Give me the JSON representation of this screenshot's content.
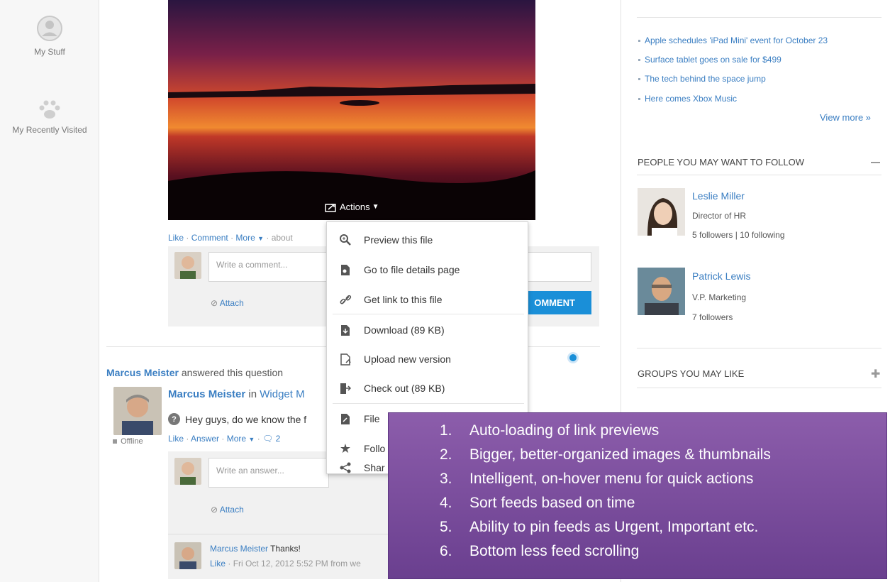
{
  "leftnav": {
    "my_stuff": "My Stuff",
    "recently_visited": "My Recently Visited"
  },
  "post1": {
    "actions_label": "Actions",
    "like": "Like",
    "comment": "Comment",
    "more": "More",
    "about": "about",
    "comment_placeholder": "Write a comment...",
    "attach": "Attach",
    "comment_button": "OMMENT"
  },
  "menu": {
    "items": [
      {
        "label": "Preview this file",
        "icon": "preview-icon"
      },
      {
        "label": "Go to file details page",
        "icon": "file-details-icon"
      },
      {
        "label": "Get link to this file",
        "icon": "link-icon"
      },
      {
        "label": "Download (89 KB)",
        "icon": "download-icon"
      },
      {
        "label": "Upload new version",
        "icon": "upload-icon"
      },
      {
        "label": "Check out (89 KB)",
        "icon": "checkout-icon"
      },
      {
        "label": "File",
        "icon": "file-icon"
      },
      {
        "label": "Follo",
        "icon": "star-icon"
      },
      {
        "label": "Shar",
        "icon": "share-icon"
      }
    ]
  },
  "post2": {
    "author": "Marcus Meister",
    "action_text": "answered this question",
    "author2": "Marcus Meister",
    "in_text": "in",
    "group": "Widget M",
    "question": "Hey guys, do we know the f",
    "offline": "Offline",
    "like": "Like",
    "answer": "Answer",
    "more": "More",
    "reply_count": "2",
    "answer_placeholder": "Write an answer...",
    "attach": "Attach",
    "reply_author": "Marcus Meister",
    "reply_text": "Thanks!",
    "reply_meta_like": "Like",
    "reply_meta": "· Fri Oct 12, 2012 5:52 PM from we"
  },
  "right": {
    "rss_items": [
      "Apple schedules 'iPad Mini' event for October 23",
      "Surface tablet goes on sale for $499",
      "The tech behind the space jump",
      "Here comes Xbox Music"
    ],
    "view_more": "View more »",
    "people_title": "PEOPLE YOU MAY WANT TO FOLLOW",
    "people": [
      {
        "name": "Leslie Miller",
        "title": "Director of HR",
        "stats": "5 followers | 10 following"
      },
      {
        "name": "Patrick Lewis",
        "title": "V.P. Marketing",
        "stats": "7 followers"
      }
    ],
    "groups_title": "GROUPS YOU MAY LIKE"
  },
  "overlay": {
    "items": [
      {
        "num": "1.",
        "text": "Auto-loading of link previews"
      },
      {
        "num": "2.",
        "text": "Bigger, better-organized images & thumbnails"
      },
      {
        "num": "3.",
        "text": "Intelligent, on-hover menu for quick actions"
      },
      {
        "num": "4.",
        "text": "Sort feeds based on time"
      },
      {
        "num": "5.",
        "text": "Ability to pin feeds as Urgent, Important etc."
      },
      {
        "num": "6.",
        "text": "Bottom less feed scrolling"
      }
    ]
  },
  "colors": {
    "link": "#3a7ec2",
    "accent": "#1a8fd8",
    "overlay": "#7a4e9e"
  }
}
